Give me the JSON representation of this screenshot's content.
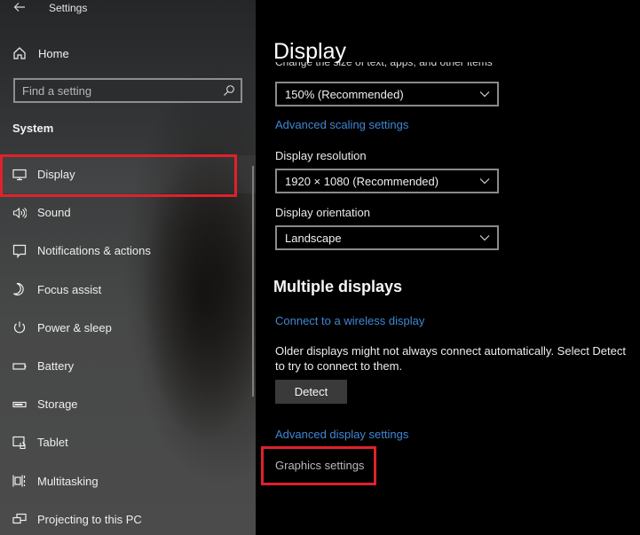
{
  "window": {
    "title": "Settings"
  },
  "sidebar": {
    "home_label": "Home",
    "search": {
      "placeholder": "Find a setting",
      "value": ""
    },
    "section_label": "System",
    "items": [
      {
        "label": "Display",
        "icon": "monitor-icon",
        "selected": true
      },
      {
        "label": "Sound",
        "icon": "speaker-icon"
      },
      {
        "label": "Notifications & actions",
        "icon": "notification-icon"
      },
      {
        "label": "Focus assist",
        "icon": "moon-icon"
      },
      {
        "label": "Power & sleep",
        "icon": "power-icon"
      },
      {
        "label": "Battery",
        "icon": "battery-icon"
      },
      {
        "label": "Storage",
        "icon": "storage-icon"
      },
      {
        "label": "Tablet",
        "icon": "tablet-icon"
      },
      {
        "label": "Multitasking",
        "icon": "multitasking-icon"
      },
      {
        "label": "Projecting to this PC",
        "icon": "projecting-icon"
      }
    ]
  },
  "main": {
    "title": "Display",
    "scale": {
      "caption": "Change the size of text, apps, and other items",
      "value": "150% (Recommended)",
      "advanced_link": "Advanced scaling settings"
    },
    "resolution": {
      "label": "Display resolution",
      "value": "1920 × 1080 (Recommended)"
    },
    "orientation": {
      "label": "Display orientation",
      "value": "Landscape"
    },
    "multiple_displays": {
      "heading": "Multiple displays",
      "wireless_link": "Connect to a wireless display",
      "description": "Older displays might not always connect automatically. Select Detect to try to connect to them.",
      "detect_button": "Detect"
    },
    "advanced_display_link": "Advanced display settings",
    "graphics_settings_link": "Graphics settings"
  },
  "colors": {
    "link": "#3f87d6",
    "highlight": "#e0212b",
    "main_background": "#000000"
  }
}
